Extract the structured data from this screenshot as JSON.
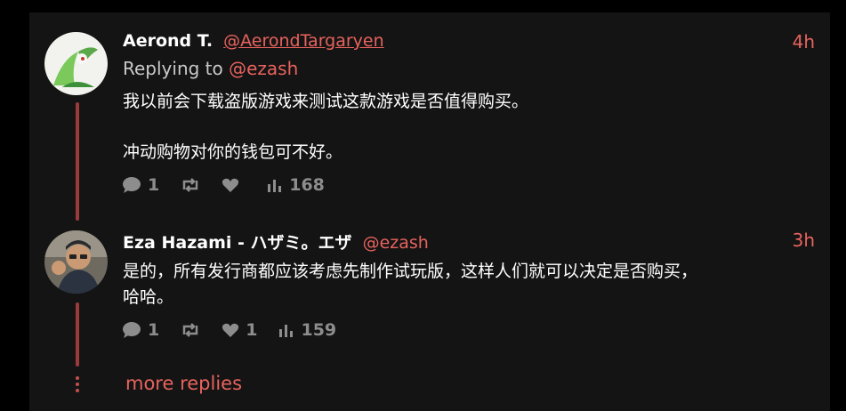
{
  "tweets": [
    {
      "name": "Aerond T.",
      "handle": "@AerondTargaryen",
      "time": "4h",
      "replying_prefix": "Replying to",
      "replying_handle": "@ezash",
      "lines": [
        "我以前会下载盗版游戏来测试这款游戏是否值得购买。",
        "冲动购物对你的钱包可不好。"
      ],
      "replies": "1",
      "likes": "",
      "views": "168"
    },
    {
      "name": "Eza Hazami - ハザミ。エザ",
      "handle": "@ezash",
      "time": "3h",
      "lines": [
        "是的，所有发行商都应该考虑先制作试玩版，这样人们就可以决定是否购买，",
        "哈哈。"
      ],
      "replies": "1",
      "likes": "1",
      "views": "159"
    }
  ],
  "more_replies": "more replies",
  "colors": {
    "accent": "#e8635e",
    "thread": "#9b3a3a",
    "muted": "#8d8d8d",
    "panel": "#141414"
  }
}
